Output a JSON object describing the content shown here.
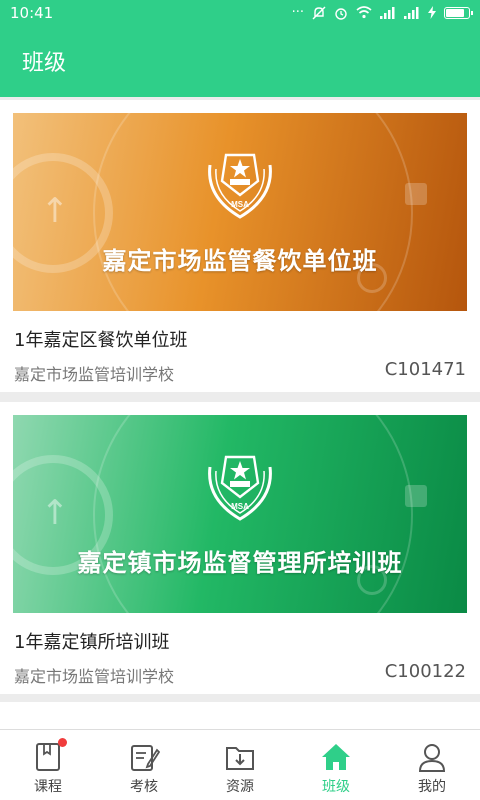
{
  "status": {
    "time": "10:41",
    "icons": [
      "dots-icon",
      "mute-icon",
      "alarm-icon",
      "wifi-icon",
      "signal-icon",
      "signal-icon",
      "charging-icon",
      "battery-icon"
    ]
  },
  "appbar": {
    "title": "班级"
  },
  "classes": [
    {
      "banner_title": "嘉定市场监管餐饮单位班",
      "emblem_text": "MSA",
      "title": "1年嘉定区餐饮单位班",
      "school": "嘉定市场监管培训学校",
      "code": "C101471",
      "theme": "orange"
    },
    {
      "banner_title": "嘉定镇市场监督管理所培训班",
      "emblem_text": "MSA",
      "title": "1年嘉定镇所培训班",
      "school": "嘉定市场监管培训学校",
      "code": "C100122",
      "theme": "green"
    }
  ],
  "tabs": [
    {
      "label": "课程",
      "icon": "book-icon",
      "badge": true
    },
    {
      "label": "考核",
      "icon": "edit-icon"
    },
    {
      "label": "资源",
      "icon": "folder-download-icon"
    },
    {
      "label": "班级",
      "icon": "house-icon",
      "active": true
    },
    {
      "label": "我的",
      "icon": "user-icon"
    }
  ],
  "colors": {
    "primary": "#2fcf89",
    "badge": "#f03c3c"
  }
}
